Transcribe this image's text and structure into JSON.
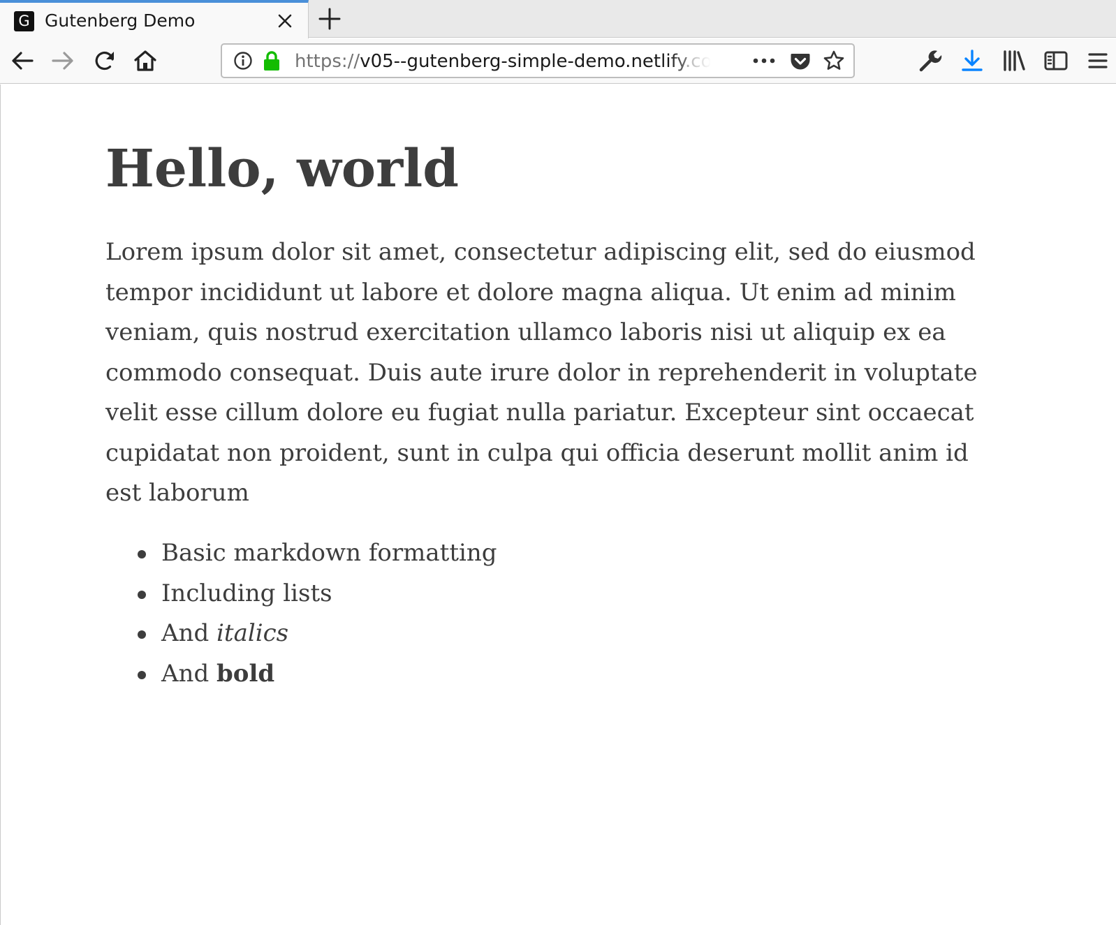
{
  "browser": {
    "tab": {
      "favicon_letter": "G",
      "title": "Gutenberg Demo"
    },
    "url": {
      "scheme": "https://",
      "host": "v05--gutenberg-simple-demo.netlify",
      "tail": ".com"
    },
    "colors": {
      "active_tab_accent": "#4a90d9",
      "lock_green": "#12bc00",
      "download_blue": "#0a84ff",
      "text": "#3d3d3d"
    },
    "icons": {
      "nav": [
        "back-arrow-icon",
        "forward-arrow-icon",
        "reload-icon",
        "home-icon"
      ],
      "url": [
        "info-icon",
        "lock-icon",
        "more-actions-icon",
        "pocket-icon",
        "bookmark-star-icon"
      ],
      "toolbar": [
        "developer-wrench-icon",
        "download-icon",
        "library-icon",
        "sidebar-icon",
        "hamburger-menu-icon"
      ]
    }
  },
  "page": {
    "heading": "Hello, world",
    "paragraph": "Lorem ipsum dolor sit amet, consectetur adipiscing elit, sed do eiusmod tempor incididunt ut labore et dolore magna aliqua. Ut enim ad minim veniam, quis nostrud exercitation ullamco laboris nisi ut aliquip ex ea commodo consequat. Duis aute irure dolor in reprehenderit in voluptate velit esse cillum dolore eu fugiat nulla pariatur. Excepteur sint occaecat cupidatat non proident, sunt in culpa qui officia deserunt mollit anim id est laborum",
    "list": [
      {
        "text": "Basic markdown formatting"
      },
      {
        "text": "Including lists"
      },
      {
        "prefix": "And ",
        "italic": "italics"
      },
      {
        "prefix": "And ",
        "bold": "bold"
      }
    ]
  }
}
